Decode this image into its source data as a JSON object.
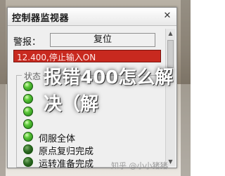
{
  "window": {
    "title": "控制器监视器",
    "close_glyph": "✕"
  },
  "alarm": {
    "label": "警报：",
    "reset_button": "复位"
  },
  "status_message": "12.400,停止输入ON",
  "status_group": {
    "label": "状态",
    "indicators": [
      {
        "text": "",
        "state": "on"
      },
      {
        "text": "",
        "state": "on"
      },
      {
        "text": "",
        "state": "on"
      },
      {
        "text": "",
        "state": "on"
      },
      {
        "text": "伺服全体",
        "state": "on"
      },
      {
        "text": "原点复归完成",
        "state": "dark"
      },
      {
        "text": "运转准备完成",
        "state": "dark"
      }
    ]
  },
  "overlay": {
    "headline": "报错400怎么解决（解"
  },
  "watermark": "知乎 @小小猪猪",
  "colors": {
    "status_bar": "#c8291f",
    "led_on": "#5cc83a",
    "led_dark": "#2f6d25",
    "overlay_text": "#ffffff"
  }
}
